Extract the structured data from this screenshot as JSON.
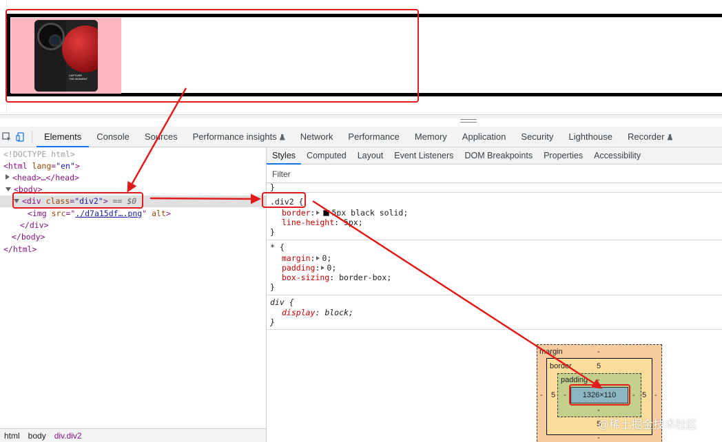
{
  "viewport": {
    "phone_text": [
      "CAPTURE",
      "THE MOMENT"
    ]
  },
  "devtools": {
    "tabs": [
      "Elements",
      "Console",
      "Sources",
      "Performance insights",
      "Network",
      "Performance",
      "Memory",
      "Application",
      "Security",
      "Lighthouse",
      "Recorder"
    ],
    "active_tab": "Elements",
    "experimental_tabs": [
      "Performance insights",
      "Recorder"
    ]
  },
  "dom": {
    "doctype": "<!DOCTYPE html>",
    "html_open": "<html ",
    "html_attr": "lang",
    "html_val": "\"en\"",
    "html_close": ">",
    "head": "<head>…</head>",
    "body_open": "<body>",
    "div_open": "<div ",
    "div_attr": "class",
    "div_val": "\"div2\"",
    "div_close": ">",
    "div_ref": "== $0",
    "img_open": "<img ",
    "img_attr": "src",
    "img_src": "./d7a15df….png",
    "img_alt": "alt",
    "img_close": ">",
    "div_end": "</div>",
    "body_end": "</body>",
    "html_end": "</html>"
  },
  "breadcrumbs": [
    "html",
    "body",
    "div.div2"
  ],
  "styles": {
    "subtabs": [
      "Styles",
      "Computed",
      "Layout",
      "Event Listeners",
      "DOM Breakpoints",
      "Properties",
      "Accessibility"
    ],
    "active_subtab": "Styles",
    "filter_placeholder": "Filter",
    "rules": [
      {
        "selector": ".div2 {",
        "decls": [
          {
            "prop": "border",
            "value": "5px black solid;",
            "swatch": "#000000"
          },
          {
            "prop": "line-height",
            "value": "5px;"
          }
        ]
      },
      {
        "selector": "* {",
        "decls": [
          {
            "prop": "margin",
            "value": "0;"
          },
          {
            "prop": "padding",
            "value": "0;"
          },
          {
            "prop": "box-sizing",
            "value": "border-box;"
          }
        ]
      },
      {
        "selector": "div {",
        "decls": [
          {
            "prop": "display",
            "value": "block;"
          }
        ]
      }
    ],
    "close_brace": "}"
  },
  "box_model": {
    "margin_label": "margin",
    "margin_value": "-",
    "border_label": "border",
    "border_top": "5",
    "border_left": "5",
    "border_right": "5",
    "border_bottom": "5",
    "padding_label": "padding",
    "padding_value": "-",
    "content": "1326×110",
    "dash": "-"
  },
  "watermark": "@稀土掘金技术社区",
  "colors": {
    "annotation": "#e11b1b",
    "image_bg": "#ffb6c1",
    "tag": "#881280",
    "attr": "#994500",
    "attr_value": "#1a1aa6",
    "css_prop": "#c80000",
    "margin_box": "#f9cc9d",
    "border_box": "#fddd9b",
    "padding_box": "#c3d08b",
    "content_box": "#8cb6c0"
  },
  "icons": [
    "inspect-element-icon",
    "device-toolbar-icon",
    "experimental-flask-icon"
  ]
}
